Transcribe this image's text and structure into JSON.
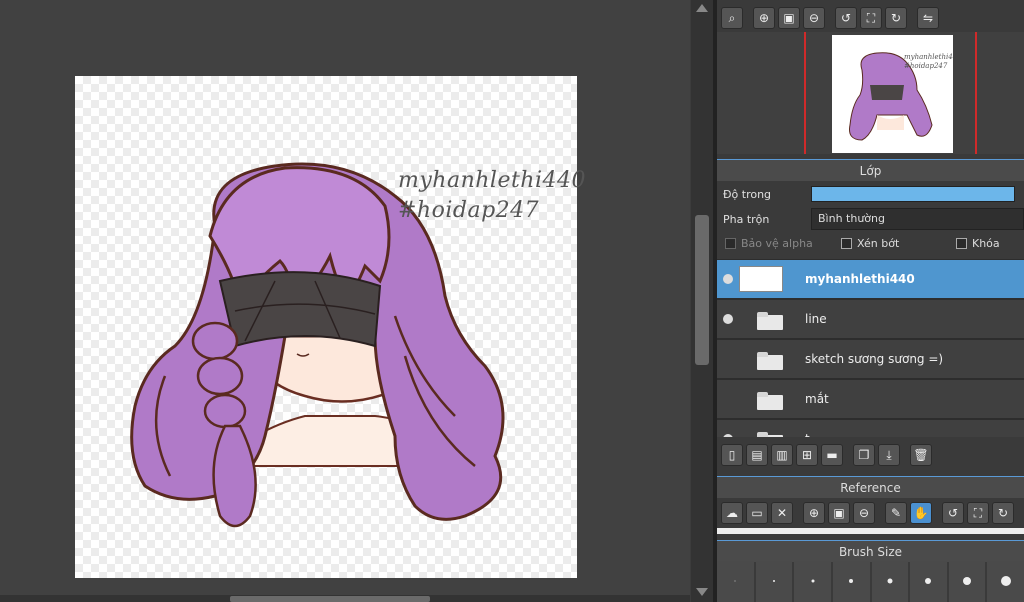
{
  "watermark": {
    "line1": "myhanhlethi440",
    "line2": "#hoidap247"
  },
  "navigator": {
    "tools": [
      "zoom-fit-icon",
      "zoom-in-icon",
      "fullscreen-icon",
      "zoom-out-icon",
      "rotate-left-icon",
      "fit-window-icon",
      "rotate-right-icon",
      "flip-icon"
    ],
    "thumb_text1": "myhanhlethi440",
    "thumb_text2": "#hoidap247"
  },
  "layer_panel": {
    "title": "Lớp",
    "opacity_label": "Độ trong",
    "opacity_value": 1.0,
    "blend_label": "Pha trộn",
    "blend_value": "Bình thường",
    "protect_alpha": "Bảo vệ alpha",
    "clipping": "Xén bớt",
    "lock": "Khóa",
    "layers": [
      {
        "name": "myhanhlethi440",
        "type": "layer",
        "visible": true,
        "selected": true
      },
      {
        "name": "line",
        "type": "folder",
        "visible": true,
        "selected": false
      },
      {
        "name": "sketch sương sương =)",
        "type": "folder",
        "visible": false,
        "selected": false
      },
      {
        "name": "mắt",
        "type": "folder",
        "visible": false,
        "selected": false
      },
      {
        "name": "t",
        "type": "folder",
        "visible": true,
        "selected": false
      }
    ]
  },
  "reference": {
    "title": "Reference"
  },
  "brush_size": {
    "title": "Brush Size"
  },
  "colors": {
    "accent": "#4f96cf",
    "opacity_fill": "#6cb6ea",
    "hair": "#b07ac8",
    "outline": "#5a2a20"
  }
}
